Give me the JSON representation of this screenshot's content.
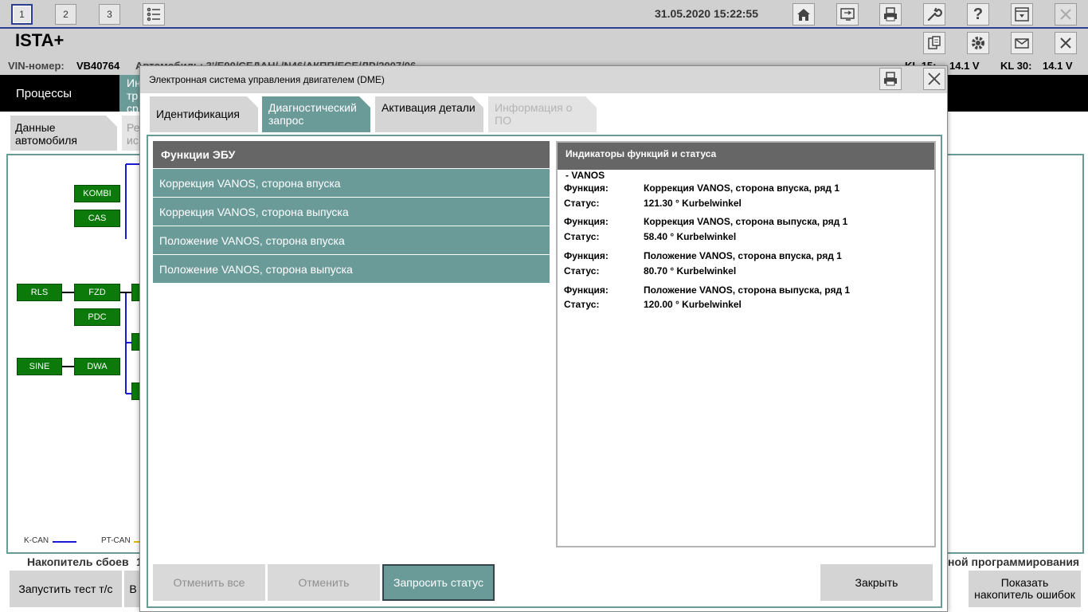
{
  "topbar": {
    "workspace_tabs": [
      "1",
      "2",
      "3"
    ],
    "datetime": "31.05.2020 15:22:55",
    "icons": [
      "list-icon",
      "home-icon",
      "switch-icon",
      "printer-icon",
      "wrench-icon",
      "help-icon",
      "download-icon",
      "close-icon"
    ]
  },
  "app": {
    "title": "ISTA+",
    "title_icons": [
      "document-icon",
      "gear-icon",
      "mail-icon",
      "close-icon"
    ]
  },
  "vinbar": {
    "vin_label": "VIN-номер:",
    "vin_value": "VB40764",
    "vehicle_partial": "Автомобиль:  3'/E90/СЕДАН/ /N46/АКПП/ЕСЕ/ЛР/2007/06",
    "kl15_label": "KL 15:",
    "kl15_value": "14.1 V",
    "kl30_label": "KL 30:",
    "kl30_value": "14.1 V"
  },
  "background": {
    "processes_tab": "Процессы",
    "partial_tab": "Ин тр ср",
    "data_tab": "Данные автомобиля",
    "partial_data_tab": "Ре ис",
    "legend": {
      "kcan": "K-CAN",
      "ptcan": "PT-CAN"
    },
    "fault_memory_label": "Накопитель сбоев",
    "fault_memory_count": "1",
    "programming_label": "ной программирования",
    "run_test_button": "Запустить тест т/с",
    "partial_button": "В",
    "show_faults_button": "Показать накопитель ошибок",
    "ecus": [
      "KOMBI",
      "CAS",
      "RLS",
      "FZD",
      "PDC",
      "SINE",
      "DWA"
    ]
  },
  "modal": {
    "title": "Электронная система управления двигателем (DME)",
    "tabs": [
      {
        "label": "Идентификация",
        "state": "normal"
      },
      {
        "label": "Диагностический запрос",
        "state": "active"
      },
      {
        "label": "Активация детали",
        "state": "normal"
      },
      {
        "label": "Информация о ПО",
        "state": "disabled"
      }
    ],
    "functions_header": "Функции ЭБУ",
    "functions": [
      "Коррекция VANOS, сторона впуска",
      "Коррекция VANOS, сторона выпуска",
      "Положение VANOS, сторона впуска",
      "Положение VANOS, сторона выпуска"
    ],
    "status_header": "Индикаторы функций и статуса",
    "group": "- VANOS",
    "function_label": "Функция:",
    "status_label": "Статус:",
    "entries": [
      {
        "function": "Коррекция VANOS, сторона впуска, ряд 1",
        "status": "121.30 ° Kurbelwinkel"
      },
      {
        "function": "Коррекция VANOS, сторона выпуска, ряд 1",
        "status": "58.40 ° Kurbelwinkel"
      },
      {
        "function": "Положение VANOS, сторона впуска, ряд 1",
        "status": "80.70 ° Kurbelwinkel"
      },
      {
        "function": "Положение VANOS, сторона выпуска, ряд 1",
        "status": "120.00 ° Kurbelwinkel"
      }
    ],
    "buttons": {
      "cancel_all": "Отменить все",
      "cancel": "Отменить",
      "request_status": "Запросить статус",
      "close": "Закрыть"
    }
  },
  "colors": {
    "teal": "#6b9b99",
    "header_dark": "#666666",
    "ecu_green": "#0b7a0b",
    "accent_blue": "#2a3f8f"
  }
}
